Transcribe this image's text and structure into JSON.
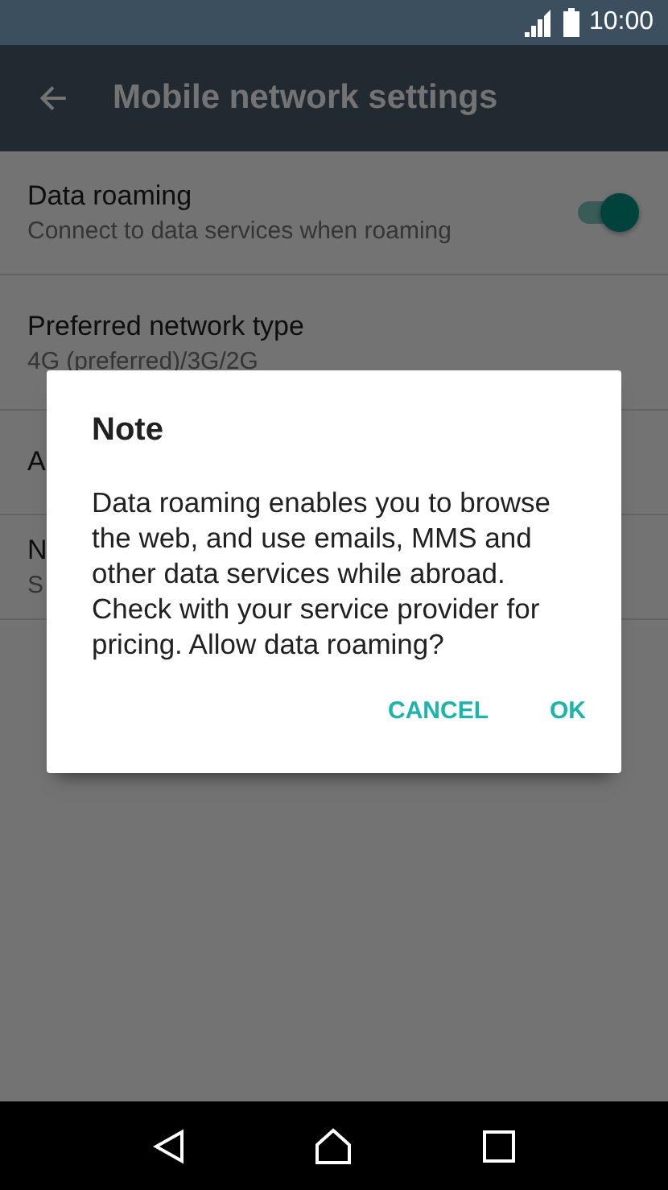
{
  "status_bar": {
    "time": "10:00"
  },
  "toolbar": {
    "title": "Mobile network settings"
  },
  "settings": [
    {
      "kind": "switch",
      "title": "Data roaming",
      "subtitle": "Connect to data services when roaming",
      "on": true
    },
    {
      "kind": "text",
      "title": "Preferred network type",
      "subtitle": "4G (preferred)/3G/2G"
    },
    {
      "kind": "text",
      "title": "A"
    },
    {
      "kind": "text",
      "title": "N",
      "subtitle": "S"
    }
  ],
  "dialog": {
    "title": "Note",
    "message": "Data roaming enables you to browse the web, and use emails, MMS and other data services while abroad. Check with your service provider for pricing. Allow data roaming?",
    "buttons": [
      "CANCEL",
      "OK"
    ]
  }
}
